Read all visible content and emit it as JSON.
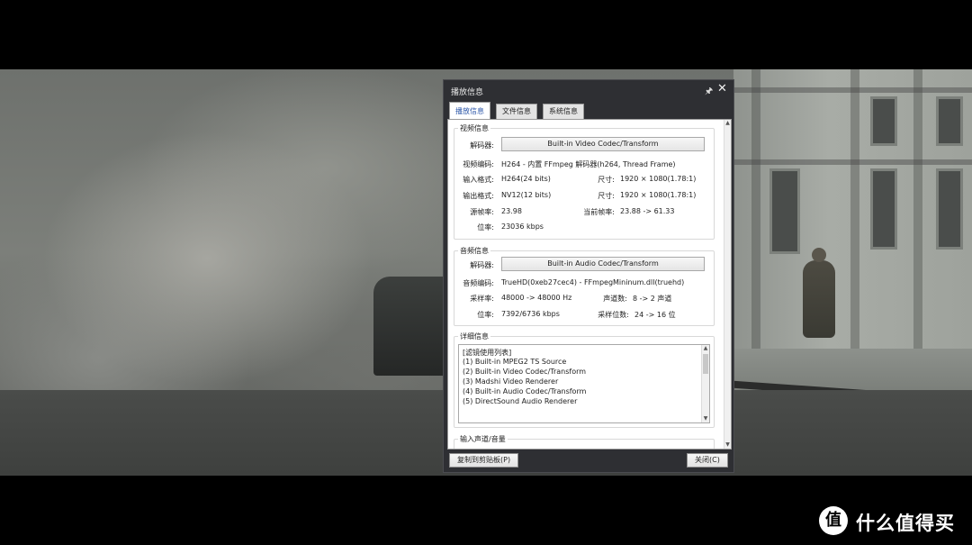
{
  "dialog": {
    "title": "播放信息",
    "pin_icon": "pin-icon",
    "close_icon": "close-icon",
    "tabs": [
      {
        "label": "播放信息",
        "active": true
      },
      {
        "label": "文件信息",
        "active": false
      },
      {
        "label": "系统信息",
        "active": false
      }
    ],
    "video": {
      "section_label": "视频信息",
      "decoder_label": "解码器:",
      "decoder_value": "Built-in Video Codec/Transform",
      "codec_label": "视频编码:",
      "codec_value": "H264 - 内置 FFmpeg 解码器(h264, Thread Frame)",
      "input_format_label": "输入格式:",
      "input_format_value": "H264(24 bits)",
      "input_size_label": "尺寸:",
      "input_size_value": "1920 × 1080(1.78:1)",
      "output_format_label": "输出格式:",
      "output_format_value": "NV12(12 bits)",
      "output_size_label": "尺寸:",
      "output_size_value": "1920 × 1080(1.78:1)",
      "source_fps_label": "源帧率:",
      "source_fps_value": "23.98",
      "current_fps_label": "当前帧率:",
      "current_fps_value": "23.88 -> 61.33",
      "bitrate_label": "位率:",
      "bitrate_value": "23036 kbps"
    },
    "audio": {
      "section_label": "音频信息",
      "decoder_label": "解码器:",
      "decoder_value": "Built-in Audio Codec/Transform",
      "codec_label": "音频编码:",
      "codec_value": "TrueHD(0xeb27cec4) - FFmpegMininum.dll(truehd)",
      "sample_rate_label": "采样率:",
      "sample_rate_value": "48000 -> 48000 Hz",
      "channels_label": "声道数:",
      "channels_value": "8 -> 2 声道",
      "bitrate_label": "位率:",
      "bitrate_value": "7392/6736 kbps",
      "bit_depth_label": "采样位数:",
      "bit_depth_value": "24 -> 16 位"
    },
    "details": {
      "section_label": "详细信息",
      "lines": [
        "[滤镜使用列表]",
        "  (1) Built-in MPEG2 TS Source",
        "  (2) Built-in Video Codec/Transform",
        "  (3) Madshi Video Renderer",
        "  (4) Built-in Audio Codec/Transform",
        "  (5) DirectSound Audio Renderer"
      ]
    },
    "input_channels": {
      "section_label": "输入声道/音量"
    },
    "copy_button": "复制到剪贴板(P)",
    "close_button": "关闭(C)"
  },
  "watermark": {
    "logo_glyph": "值",
    "text": "什么值得买"
  }
}
